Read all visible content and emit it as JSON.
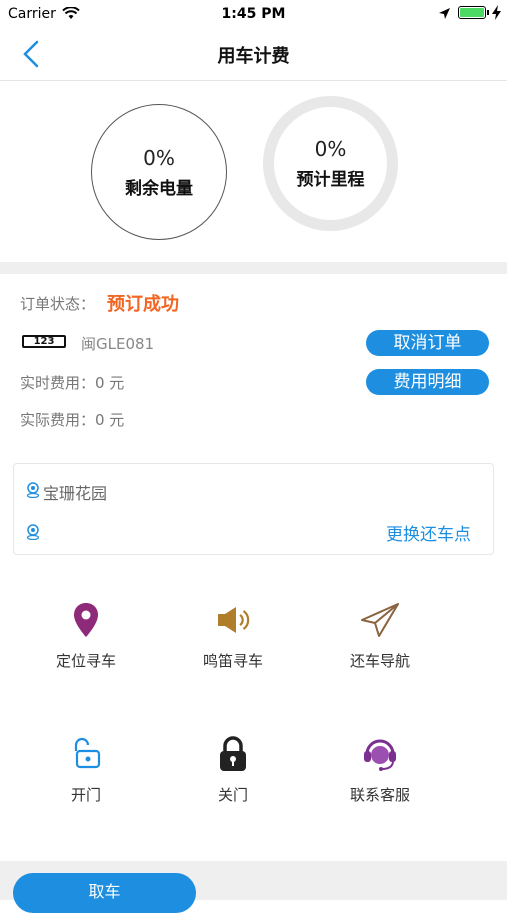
{
  "status_bar": {
    "carrier": "Carrier",
    "time": "1:45 PM"
  },
  "nav": {
    "title": "用车计费"
  },
  "gauges": [
    {
      "percent": "0%",
      "label": "剩余电量"
    },
    {
      "percent": "0%",
      "label": "预计里程"
    }
  ],
  "order": {
    "status_label": "订单状态：",
    "status_value": "预订成功",
    "plate_badge": "123",
    "plate_number": "闽GLE081",
    "cancel_button": "取消订单",
    "realtime_fee": "实时费用：0 元",
    "detail_button": "费用明细",
    "actual_fee": "实际费用：0 元"
  },
  "location": {
    "pickup": "宝珊花园",
    "change_return": "更换还车点"
  },
  "actions": [
    {
      "label": "定位寻车",
      "icon": "location-pin-icon"
    },
    {
      "label": "鸣笛寻车",
      "icon": "speaker-icon"
    },
    {
      "label": "还车导航",
      "icon": "paper-plane-icon"
    },
    {
      "label": "开门",
      "icon": "unlock-icon"
    },
    {
      "label": "关门",
      "icon": "lock-icon"
    },
    {
      "label": "联系客服",
      "icon": "customer-service-icon"
    }
  ],
  "footer": {
    "pickup_button": "取车"
  },
  "colors": {
    "accent": "#1e8fe0",
    "status_orange": "#f26522",
    "pin_purple": "#8e2a7a"
  }
}
